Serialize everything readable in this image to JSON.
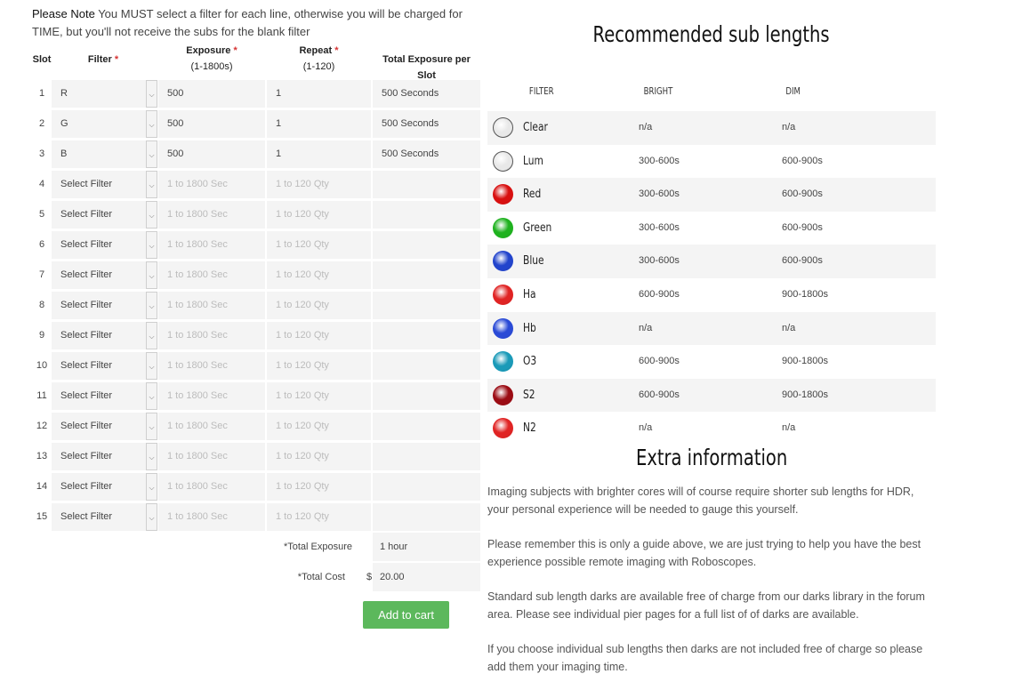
{
  "note": {
    "lead": "Please Note",
    "text": " You MUST select a filter for each line, otherwise you will be charged for TIME, but you'll not receive the subs for the blank filter"
  },
  "table": {
    "headers": {
      "slot": "Slot",
      "filter": "Filter",
      "exposure": "Exposure",
      "exposure_range": "(1-1800s)",
      "repeat": "Repeat",
      "repeat_range": "(1-120)",
      "total": "Total Exposure per Slot",
      "required_mark": "*"
    },
    "placeholders": {
      "filter": "Select Filter",
      "exposure": "1 to 1800 Sec",
      "repeat": "1 to 120 Qty"
    },
    "rows": [
      {
        "slot": "1",
        "filter": "R",
        "exposure": "500",
        "repeat": "1",
        "total": "500 Seconds"
      },
      {
        "slot": "2",
        "filter": "G",
        "exposure": "500",
        "repeat": "1",
        "total": "500 Seconds"
      },
      {
        "slot": "3",
        "filter": "B",
        "exposure": "500",
        "repeat": "1",
        "total": "500 Seconds"
      },
      {
        "slot": "4",
        "filter": "",
        "exposure": "",
        "repeat": "",
        "total": ""
      },
      {
        "slot": "5",
        "filter": "",
        "exposure": "",
        "repeat": "",
        "total": ""
      },
      {
        "slot": "6",
        "filter": "",
        "exposure": "",
        "repeat": "",
        "total": ""
      },
      {
        "slot": "7",
        "filter": "",
        "exposure": "",
        "repeat": "",
        "total": ""
      },
      {
        "slot": "8",
        "filter": "",
        "exposure": "",
        "repeat": "",
        "total": ""
      },
      {
        "slot": "9",
        "filter": "",
        "exposure": "",
        "repeat": "",
        "total": ""
      },
      {
        "slot": "10",
        "filter": "",
        "exposure": "",
        "repeat": "",
        "total": ""
      },
      {
        "slot": "11",
        "filter": "",
        "exposure": "",
        "repeat": "",
        "total": ""
      },
      {
        "slot": "12",
        "filter": "",
        "exposure": "",
        "repeat": "",
        "total": ""
      },
      {
        "slot": "13",
        "filter": "",
        "exposure": "",
        "repeat": "",
        "total": ""
      },
      {
        "slot": "14",
        "filter": "",
        "exposure": "",
        "repeat": "",
        "total": ""
      },
      {
        "slot": "15",
        "filter": "",
        "exposure": "",
        "repeat": "",
        "total": ""
      }
    ],
    "summary": {
      "total_exposure_label": "*Total Exposure",
      "total_exposure_value": "1 hour",
      "total_cost_label": "*Total Cost",
      "currency": "$",
      "total_cost_value": "20.00"
    },
    "add_to_cart": "Add to cart"
  },
  "recommended": {
    "title": "Recommended sub lengths",
    "headers": {
      "filter": "FILTER",
      "bright": "BRIGHT",
      "dim": "DIM"
    },
    "filters": [
      {
        "name": "Clear",
        "bright": "n/a",
        "dim": "n/a",
        "color": "#e8e8e8"
      },
      {
        "name": "Lum",
        "bright": "300-600s",
        "dim": "600-900s",
        "color": "#e8e8e8"
      },
      {
        "name": "Red",
        "bright": "300-600s",
        "dim": "600-900s",
        "color": "#d81010"
      },
      {
        "name": "Green",
        "bright": "300-600s",
        "dim": "600-900s",
        "color": "#1fb21f"
      },
      {
        "name": "Blue",
        "bright": "300-600s",
        "dim": "600-900s",
        "color": "#2244cc"
      },
      {
        "name": "Ha",
        "bright": "600-900s",
        "dim": "900-1800s",
        "color": "#e02424"
      },
      {
        "name": "Hb",
        "bright": "n/a",
        "dim": "n/a",
        "color": "#2a4ad6"
      },
      {
        "name": "O3",
        "bright": "600-900s",
        "dim": "900-1800s",
        "color": "#1a9ab8"
      },
      {
        "name": "S2",
        "bright": "600-900s",
        "dim": "900-1800s",
        "color": "#9b0c14"
      },
      {
        "name": "N2",
        "bright": "n/a",
        "dim": "n/a",
        "color": "#e02424"
      }
    ]
  },
  "extra": {
    "title": "Extra information",
    "paragraphs": [
      "Imaging subjects with brighter cores will of course require shorter sub lengths for HDR, your personal experience will be needed to gauge this yourself.",
      "Please remember this is only a guide above, we are just trying to help you have the best experience possible remote imaging with Roboscopes.",
      "Standard sub length darks are available free of charge from our darks library in the forum area. Please see individual pier pages for a full list of of darks are available.",
      "If you choose individual sub lengths then darks are not included free of charge so please add them your imaging time."
    ]
  },
  "colors": {
    "accent_green": "#5cb85c",
    "required_red": "#d63333",
    "row_alt": "#f4f4f4"
  }
}
